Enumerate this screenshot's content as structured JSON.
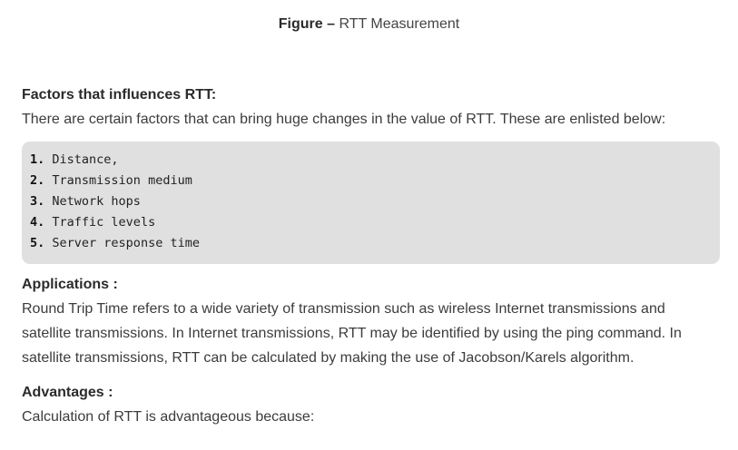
{
  "figure": {
    "label": "Figure –",
    "title": "RTT Measurement"
  },
  "factors": {
    "heading": "Factors that influences RTT:",
    "intro": "There are certain factors that can bring huge changes in the value of RTT. These are enlisted below:",
    "items": [
      {
        "num": "1.",
        "text": "Distance,"
      },
      {
        "num": "2.",
        "text": "Transmission medium"
      },
      {
        "num": "3.",
        "text": "Network hops"
      },
      {
        "num": "4.",
        "text": "Traffic levels"
      },
      {
        "num": "5.",
        "text": "Server response time"
      }
    ]
  },
  "applications": {
    "heading": "Applications :",
    "body": "Round Trip Time refers to a wide variety of transmission such as wireless Internet transmissions and satellite transmissions. In Internet transmissions, RTT may be identified by using the ping command. In satellite transmissions, RTT can be calculated by making the use of Jacobson/Karels algorithm."
  },
  "advantages": {
    "heading": "Advantages :",
    "body": "Calculation of RTT is advantageous because:"
  }
}
